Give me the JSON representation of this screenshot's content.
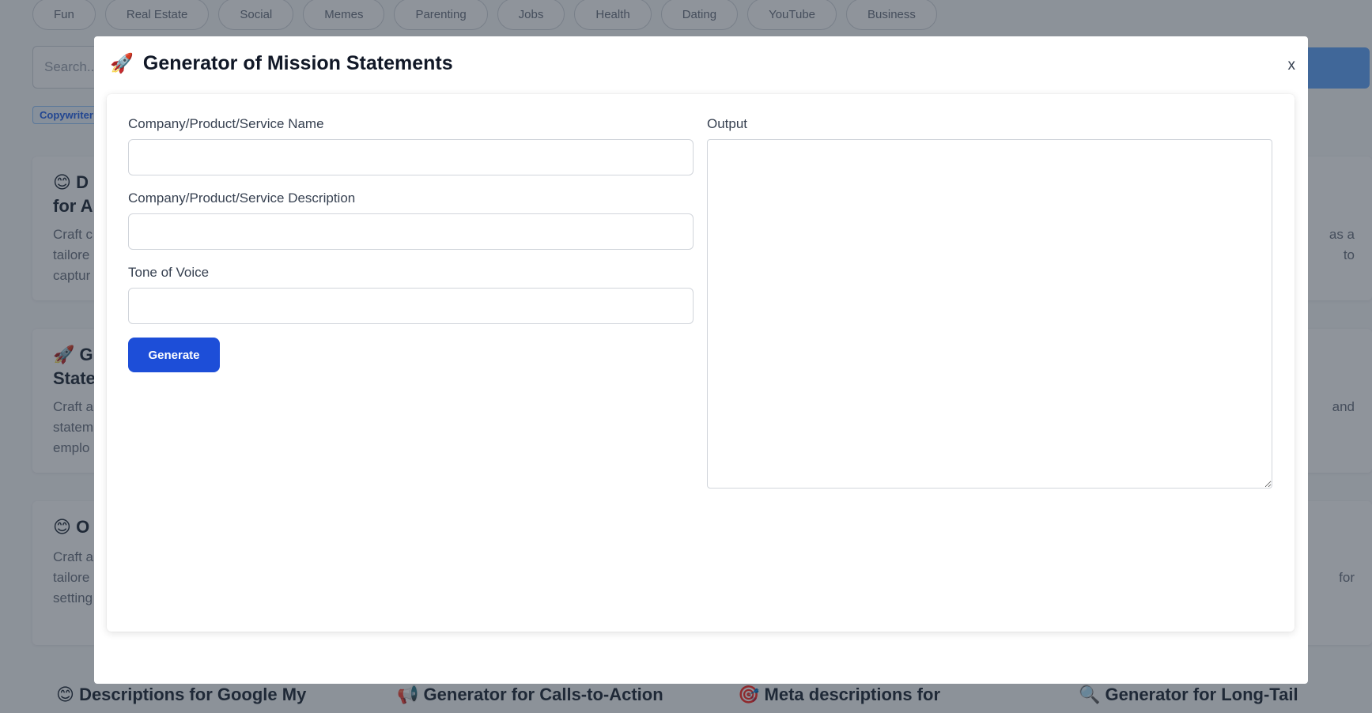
{
  "background": {
    "categories": [
      "Fun",
      "Real Estate",
      "Social",
      "Memes",
      "Parenting",
      "Jobs",
      "Health",
      "Dating",
      "YouTube",
      "Business"
    ],
    "search_placeholder": "Search...",
    "tag": "Copywriter",
    "cards": [
      {
        "icon": "😊",
        "title_line1": "D",
        "title_line2": "for A",
        "desc": [
          "Craft c",
          "tailore",
          "captur"
        ],
        "right": [
          "as a",
          "to"
        ]
      },
      {
        "icon": "🚀",
        "title_line1": "G",
        "title_line2": "State",
        "desc": [
          "Craft a",
          "statem",
          "emplo"
        ],
        "right": [
          "and"
        ]
      },
      {
        "icon": "😊",
        "title_line1": "O",
        "title_line2": "",
        "desc": [
          "Craft a",
          "tailore",
          "setting"
        ],
        "right": [
          "for"
        ]
      }
    ],
    "bottom_cards": [
      {
        "icon": "😊",
        "title": "Descriptions for Google My"
      },
      {
        "icon": "📢",
        "title": "Generator for Calls-to-Action"
      },
      {
        "icon": "🎯",
        "title": "Meta descriptions for"
      },
      {
        "icon": "🔍",
        "title": "Generator for Long-Tail"
      }
    ]
  },
  "modal": {
    "icon": "🚀",
    "title": "Generator of Mission Statements",
    "close_label": "x",
    "fields": [
      {
        "label": "Company/Product/Service Name",
        "value": "",
        "placeholder": ""
      },
      {
        "label": "Company/Product/Service Description",
        "value": "",
        "placeholder": ""
      },
      {
        "label": "Tone of Voice",
        "value": "",
        "placeholder": ""
      }
    ],
    "generate_label": "Generate",
    "output_label": "Output",
    "output_value": ""
  }
}
